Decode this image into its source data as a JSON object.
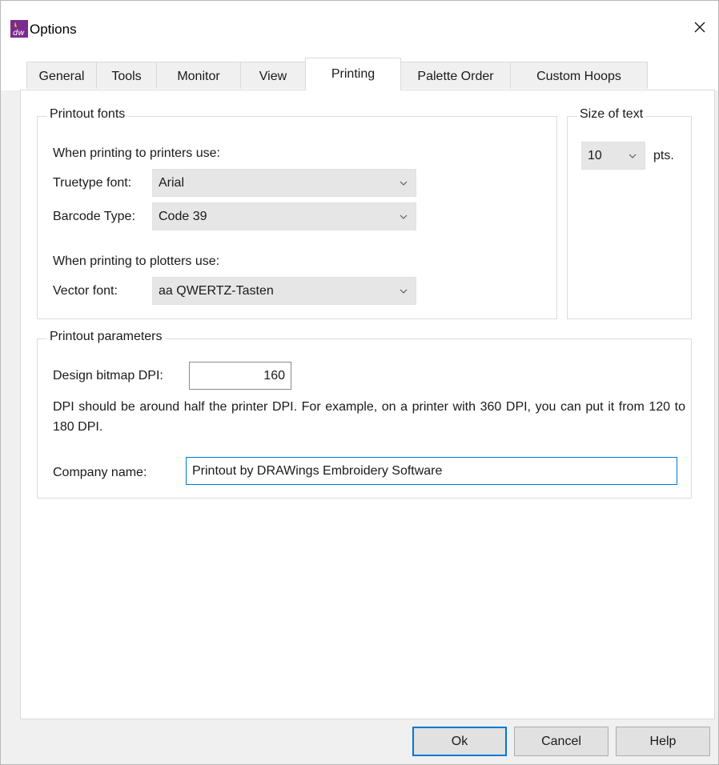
{
  "window": {
    "title": "Options",
    "accent_color": "#0078d7",
    "icon_color": "#7b2b8f"
  },
  "tabs": [
    {
      "label": "General"
    },
    {
      "label": "Tools"
    },
    {
      "label": "Monitor"
    },
    {
      "label": "View"
    },
    {
      "label": "Printing",
      "active": true
    },
    {
      "label": "Palette Order"
    },
    {
      "label": "Custom Hoops"
    }
  ],
  "printout_fonts": {
    "title": "Printout fonts",
    "printers_heading": "When printing to printers use:",
    "truetype_label": "Truetype font:",
    "truetype_value": "Arial",
    "barcode_label": "Barcode Type:",
    "barcode_value": "Code 39",
    "plotters_heading": "When printing to plotters use:",
    "vector_label": "Vector font:",
    "vector_value": "aa QWERTZ-Tasten"
  },
  "size_of_text": {
    "title": "Size of text",
    "value": "10",
    "unit": "pts."
  },
  "printout_parameters": {
    "title": "Printout parameters",
    "dpi_label": "Design bitmap DPI:",
    "dpi_value": "160",
    "description": "DPI should be around half the printer DPI. For example, on a printer with 360 DPI, you can put it from 120 to 180 DPI.",
    "company_label": "Company name:",
    "company_value": "Printout by DRAWings Embroidery Software"
  },
  "buttons": {
    "ok": "Ok",
    "cancel": "Cancel",
    "help": "Help"
  }
}
